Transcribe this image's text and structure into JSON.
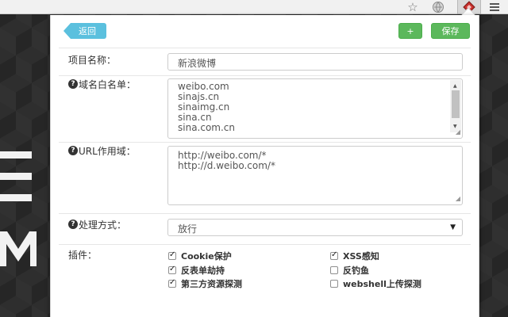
{
  "browser": {
    "star_icon": "star-icon",
    "globe_icon": "globe-icon",
    "extension_icon": "extension-diamond-icon",
    "menu_icon": "hamburger-menu-icon"
  },
  "header": {
    "back_label": "返回",
    "plus_label": "+",
    "save_label": "保存"
  },
  "form": {
    "project_name": {
      "label": "项目名称：",
      "value": "新浪微博"
    },
    "whitelist": {
      "label": "域名白名单：",
      "lines": [
        "weibo.com",
        "sinajs.cn",
        "sinaimg.cn",
        "sina.cn",
        "sina.com.cn"
      ]
    },
    "url_scope": {
      "label": "URL作用域：",
      "lines": [
        "http://weibo.com/*",
        "http://d.weibo.com/*"
      ]
    },
    "handling": {
      "label": "处理方式：",
      "selected": "放行"
    },
    "plugins": {
      "label": "插件：",
      "items": [
        {
          "label": "Cookie保护",
          "checked": true
        },
        {
          "label": "XSS感知",
          "checked": true
        },
        {
          "label": "反表单劫持",
          "checked": true
        },
        {
          "label": "反钓鱼",
          "checked": false
        },
        {
          "label": "第三方资源探测",
          "checked": true
        },
        {
          "label": "webshell上传探测",
          "checked": false
        }
      ]
    }
  },
  "colors": {
    "back_button": "#5bc0de",
    "green_button": "#5cb85c",
    "background": "#262626"
  }
}
